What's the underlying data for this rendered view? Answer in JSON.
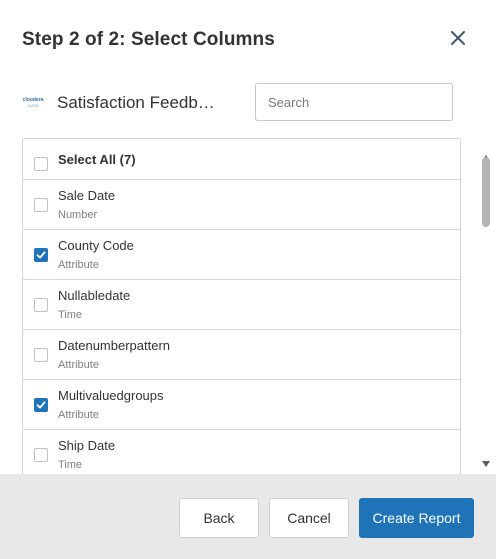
{
  "dialog": {
    "title": "Step 2 of 2: Select Columns"
  },
  "source": {
    "logo_line1": "cloudera",
    "logo_line2": "DATA",
    "name": "Satisfaction Feedb…"
  },
  "search": {
    "value": "",
    "placeholder": "Search"
  },
  "select_all": {
    "label": "Select All (7)",
    "checked": false
  },
  "columns": [
    {
      "name": "Sale Date",
      "type": "Number",
      "checked": false
    },
    {
      "name": "County Code",
      "type": "Attribute",
      "checked": true
    },
    {
      "name": "Nullabledate",
      "type": "Time",
      "checked": false
    },
    {
      "name": "Datenumberpattern",
      "type": "Attribute",
      "checked": false
    },
    {
      "name": "Multivaluedgroups",
      "type": "Attribute",
      "checked": true
    },
    {
      "name": "Ship Date",
      "type": "Time",
      "checked": false
    }
  ],
  "footer": {
    "back_label": "Back",
    "cancel_label": "Cancel",
    "create_label": "Create Report"
  },
  "colors": {
    "accent": "#1f74b8",
    "footer_bg": "#e8e8e8"
  },
  "icons": {
    "close": "close-icon",
    "checkbox_checked": "checkmark-icon"
  }
}
